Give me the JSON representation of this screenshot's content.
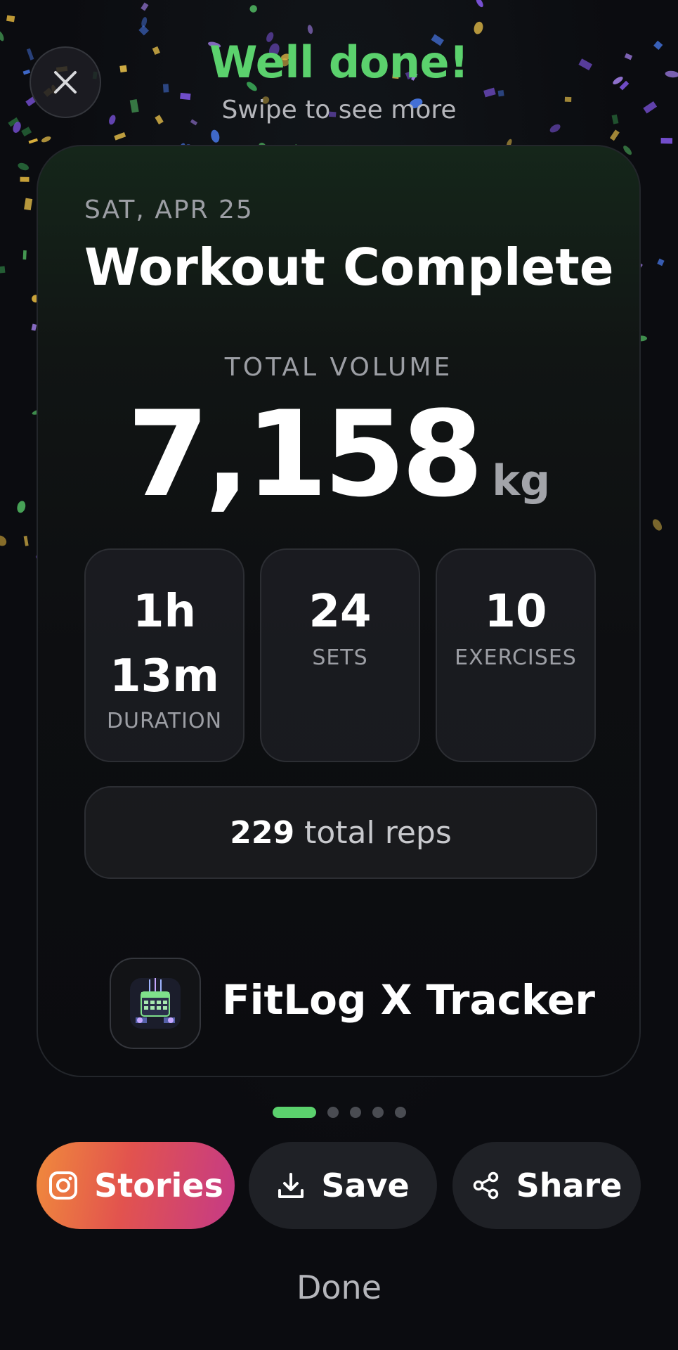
{
  "header": {
    "title": "Well done!",
    "subtitle": "Swipe to see more",
    "close_icon": "close-icon",
    "accent_color": "#5bd16d"
  },
  "card": {
    "date": "SAT, APR 25",
    "title": "Workout Complete",
    "volume_label": "TOTAL VOLUME",
    "volume_value": "7,158",
    "volume_unit": "kg",
    "stats": [
      {
        "value_line1": "1h",
        "value_line2": "13m",
        "label": "DURATION"
      },
      {
        "value": "24",
        "label": "SETS"
      },
      {
        "value": "10",
        "label": "EXERCISES"
      }
    ],
    "reps_value": "229",
    "reps_text": "total reps",
    "brand_name": "FitLog X Tracker",
    "brand_icon": "app-logo-icon"
  },
  "pager": {
    "count": 5,
    "active_index": 0
  },
  "actions": {
    "stories_label": "Stories",
    "stories_icon": "instagram-icon",
    "save_label": "Save",
    "save_icon": "download-icon",
    "share_label": "Share",
    "share_icon": "share-icon"
  },
  "done_label": "Done"
}
